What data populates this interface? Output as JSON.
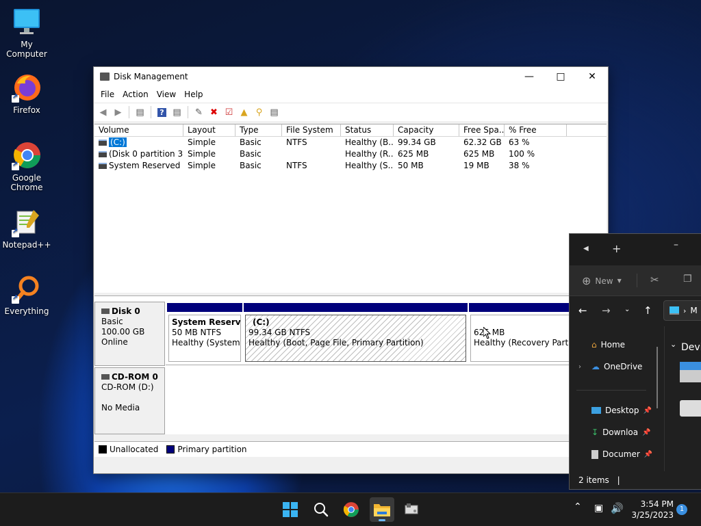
{
  "desktop": {
    "icons": [
      {
        "label": "My Computer"
      },
      {
        "label": "Firefox"
      },
      {
        "label": "Google Chrome"
      },
      {
        "label": "Notepad++"
      },
      {
        "label": "Everything"
      }
    ]
  },
  "disk_management": {
    "title": "Disk Management",
    "menu": [
      "File",
      "Action",
      "View",
      "Help"
    ],
    "columns": [
      "Volume",
      "Layout",
      "Type",
      "File System",
      "Status",
      "Capacity",
      "Free Spa...",
      "% Free"
    ],
    "rows": [
      {
        "volume": "(C:)",
        "layout": "Simple",
        "type": "Basic",
        "fs": "NTFS",
        "status": "Healthy (B...",
        "capacity": "99.34 GB",
        "free": "62.32 GB",
        "pct": "63 %"
      },
      {
        "volume": "(Disk 0 partition 3)",
        "layout": "Simple",
        "type": "Basic",
        "fs": "",
        "status": "Healthy (R...",
        "capacity": "625 MB",
        "free": "625 MB",
        "pct": "100 %"
      },
      {
        "volume": "System Reserved",
        "layout": "Simple",
        "type": "Basic",
        "fs": "NTFS",
        "status": "Healthy (S...",
        "capacity": "50 MB",
        "free": "19 MB",
        "pct": "38 %"
      }
    ],
    "disk0": {
      "name": "Disk 0",
      "type": "Basic",
      "size": "100.00 GB",
      "state": "Online",
      "partitions": [
        {
          "title": "System Reserved",
          "line1": "50 MB NTFS",
          "line2": "Healthy (System, A"
        },
        {
          "title": "(C:)",
          "line1": "99.34 GB NTFS",
          "line2": "Healthy (Boot, Page File, Primary Partition)"
        },
        {
          "title": "",
          "line1": "625 MB",
          "line2": "Healthy (Recovery Partition"
        }
      ]
    },
    "cdrom": {
      "name": "CD-ROM 0",
      "drive": "CD-ROM (D:)",
      "media": "No Media"
    },
    "legend": {
      "unallocated": "Unallocated",
      "primary": "Primary partition"
    },
    "colors": {
      "primary": "#00007b",
      "selection": "#0078d7"
    }
  },
  "explorer": {
    "new_label": "New",
    "breadcrumb_partial": "M",
    "section_partial": "Devi",
    "nav": {
      "home": "Home",
      "onedrive": "OneDrive",
      "desktop": "Desktop",
      "downloads": "Downloa",
      "documents": "Documer"
    },
    "status": "2 items"
  },
  "taskbar": {
    "time": "3:54 PM",
    "date": "3/25/2023",
    "notification_count": "1"
  }
}
